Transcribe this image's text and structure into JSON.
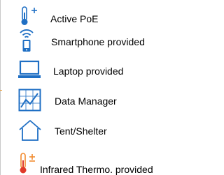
{
  "legend": {
    "items": [
      {
        "label": "Active PoE",
        "icon": "thermometer-plus-icon"
      },
      {
        "label": "Smartphone provided",
        "icon": "smartphone-wireless-icon"
      },
      {
        "label": "Laptop provided",
        "icon": "laptop-icon"
      },
      {
        "label": "Data Manager",
        "icon": "data-manager-chart-icon"
      },
      {
        "label": "Tent/Shelter",
        "icon": "tent-shelter-icon"
      },
      {
        "label": "Infrared Thermo. provided",
        "icon": "infrared-thermometer-icon"
      }
    ]
  },
  "colors": {
    "icon_blue": "#1f6fc4",
    "icon_orange": "#f28a2e",
    "icon_red": "#e03a2a",
    "text": "#000000"
  }
}
